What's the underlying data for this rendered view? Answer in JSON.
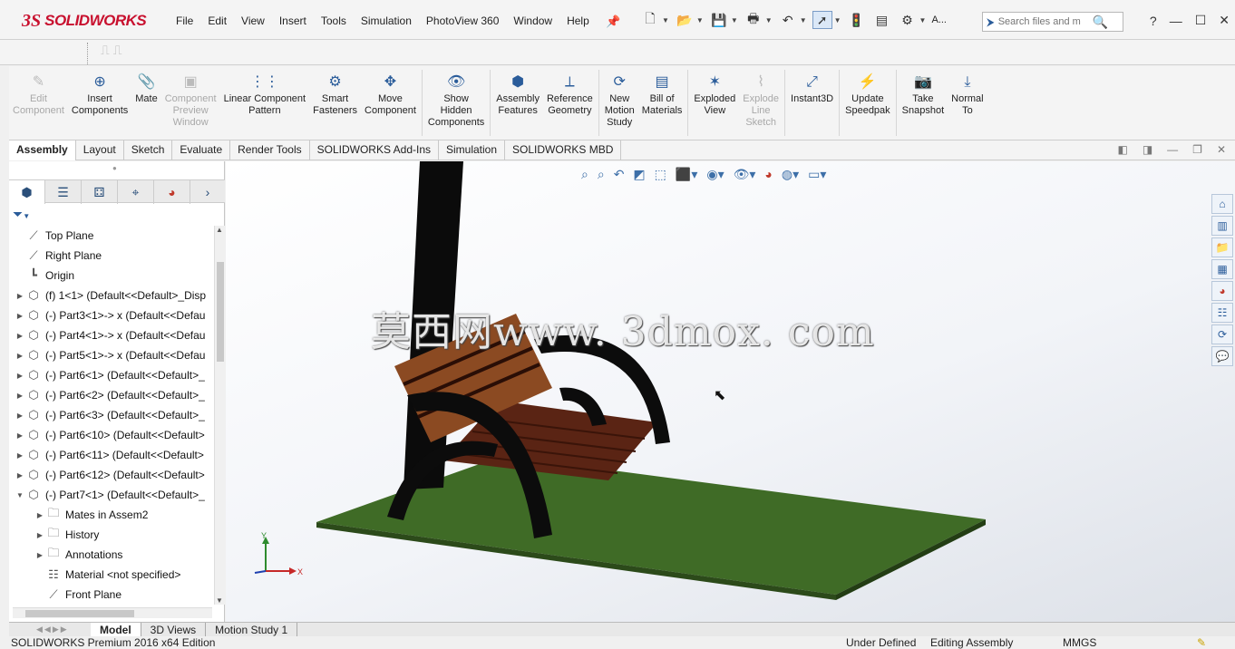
{
  "app": {
    "brand_ds": "3S",
    "brand_name": "SOLIDWORKS"
  },
  "menu": [
    "File",
    "Edit",
    "View",
    "Insert",
    "Tools",
    "Simulation",
    "PhotoView 360",
    "Window",
    "Help"
  ],
  "search": {
    "placeholder": "Search files and m",
    "label": "A..."
  },
  "commands": [
    {
      "label": "Edit\nComponent",
      "icon": "edit-component-icon",
      "disabled": true
    },
    {
      "label": "Insert\nComponents",
      "icon": "insert-components-icon",
      "disabled": false
    },
    {
      "label": "Mate",
      "icon": "mate-icon",
      "disabled": false
    },
    {
      "label": "Component\nPreview\nWindow",
      "icon": "component-preview-icon",
      "disabled": true
    },
    {
      "label": "Linear Component\nPattern",
      "icon": "linear-pattern-icon",
      "disabled": false
    },
    {
      "label": "Smart\nFasteners",
      "icon": "smart-fasteners-icon",
      "disabled": false
    },
    {
      "label": "Move\nComponent",
      "icon": "move-component-icon",
      "disabled": false
    },
    {
      "label": "Show\nHidden\nComponents",
      "icon": "show-hidden-icon",
      "disabled": false
    },
    {
      "label": "Assembly\nFeatures",
      "icon": "assembly-features-icon",
      "disabled": false
    },
    {
      "label": "Reference\nGeometry",
      "icon": "reference-geometry-icon",
      "disabled": false
    },
    {
      "label": "New\nMotion\nStudy",
      "icon": "motion-study-icon",
      "disabled": false
    },
    {
      "label": "Bill of\nMaterials",
      "icon": "bill-of-materials-icon",
      "disabled": false
    },
    {
      "label": "Exploded\nView",
      "icon": "exploded-view-icon",
      "disabled": false
    },
    {
      "label": "Explode\nLine\nSketch",
      "icon": "explode-line-sketch-icon",
      "disabled": true
    },
    {
      "label": "Instant3D",
      "icon": "instant3d-icon",
      "disabled": false
    },
    {
      "label": "Update\nSpeedpak",
      "icon": "speedpak-icon",
      "disabled": false
    },
    {
      "label": "Take\nSnapshot",
      "icon": "camera-icon",
      "disabled": false
    },
    {
      "label": "Normal\nTo",
      "icon": "normal-to-icon",
      "disabled": false
    }
  ],
  "tabs": [
    "Assembly",
    "Layout",
    "Sketch",
    "Evaluate",
    "Render Tools",
    "SOLIDWORKS Add-Ins",
    "Simulation",
    "SOLIDWORKS MBD"
  ],
  "active_tab": "Assembly",
  "tree": [
    {
      "label": "Top Plane",
      "indent": 0,
      "expand": "",
      "icon": "plane-icon"
    },
    {
      "label": "Right Plane",
      "indent": 0,
      "expand": "",
      "icon": "plane-icon"
    },
    {
      "label": "Origin",
      "indent": 0,
      "expand": "",
      "icon": "origin-icon"
    },
    {
      "label": "(f) 1<1> (Default<<Default>_Disp",
      "indent": 0,
      "expand": "▶",
      "icon": "part-icon"
    },
    {
      "label": "(-) Part3<1>-> x (Default<<Defau",
      "indent": 0,
      "expand": "▶",
      "icon": "part-icon"
    },
    {
      "label": "(-) Part4<1>-> x (Default<<Defau",
      "indent": 0,
      "expand": "▶",
      "icon": "part-icon"
    },
    {
      "label": "(-) Part5<1>-> x (Default<<Defau",
      "indent": 0,
      "expand": "▶",
      "icon": "part-icon"
    },
    {
      "label": "(-) Part6<1> (Default<<Default>_",
      "indent": 0,
      "expand": "▶",
      "icon": "part-icon"
    },
    {
      "label": "(-) Part6<2> (Default<<Default>_",
      "indent": 0,
      "expand": "▶",
      "icon": "part-icon"
    },
    {
      "label": "(-) Part6<3> (Default<<Default>_",
      "indent": 0,
      "expand": "▶",
      "icon": "part-icon"
    },
    {
      "label": "(-) Part6<10> (Default<<Default>",
      "indent": 0,
      "expand": "▶",
      "icon": "part-icon"
    },
    {
      "label": "(-) Part6<11> (Default<<Default>",
      "indent": 0,
      "expand": "▶",
      "icon": "part-icon"
    },
    {
      "label": "(-) Part6<12> (Default<<Default>",
      "indent": 0,
      "expand": "▶",
      "icon": "part-icon"
    },
    {
      "label": "(-) Part7<1> (Default<<Default>_",
      "indent": 0,
      "expand": "▼",
      "icon": "part-icon"
    },
    {
      "label": "Mates in Assem2",
      "indent": 1,
      "expand": "▶",
      "icon": "mates-folder-icon"
    },
    {
      "label": "History",
      "indent": 1,
      "expand": "▶",
      "icon": "history-folder-icon"
    },
    {
      "label": "Annotations",
      "indent": 1,
      "expand": "▶",
      "icon": "annotations-folder-icon"
    },
    {
      "label": "Material <not specified>",
      "indent": 1,
      "expand": "",
      "icon": "material-icon"
    },
    {
      "label": "Front Plane",
      "indent": 1,
      "expand": "",
      "icon": "plane-icon"
    }
  ],
  "viewport": {
    "watermark": "莫西网www. 3dmox. com",
    "triad_x": "X",
    "triad_y": "Y"
  },
  "bottom_tabs": [
    "Model",
    "3D Views",
    "Motion Study 1"
  ],
  "active_bottom_tab": "Model",
  "status": {
    "edition": "SOLIDWORKS Premium 2016 x64 Edition",
    "defined": "Under Defined",
    "mode": "Editing Assembly",
    "units": "MMGS"
  }
}
